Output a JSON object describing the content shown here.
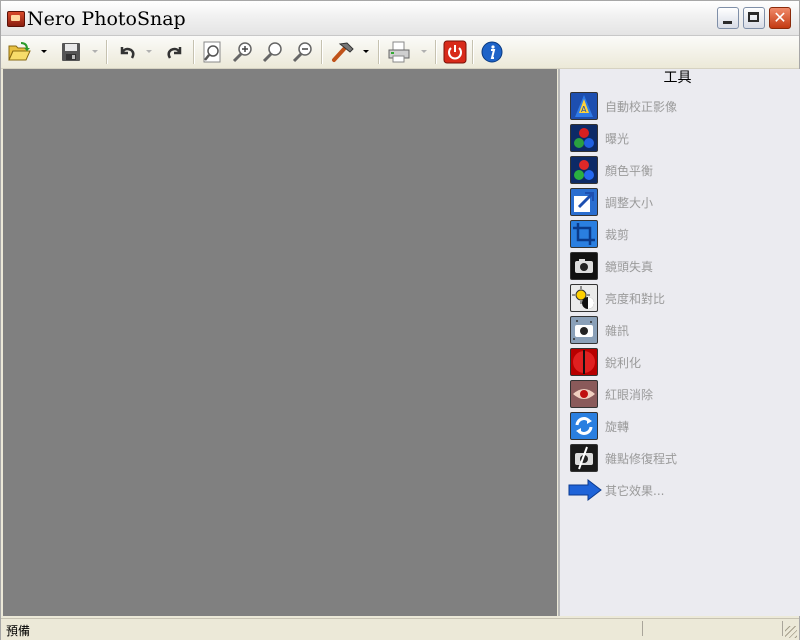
{
  "window": {
    "title": "Nero PhotoSnap"
  },
  "toolbar": {
    "buttons": [
      {
        "icon": "open-folder-icon"
      },
      {
        "icon": "save-icon"
      },
      {
        "icon": "undo-icon"
      },
      {
        "icon": "redo-icon"
      },
      {
        "icon": "zoom-fit-icon"
      },
      {
        "icon": "zoom-in-icon"
      },
      {
        "icon": "zoom-actual-icon"
      },
      {
        "icon": "zoom-out-icon"
      },
      {
        "icon": "hammer-tools-icon"
      },
      {
        "icon": "print-icon"
      },
      {
        "icon": "power-exit-icon"
      },
      {
        "icon": "info-icon"
      }
    ]
  },
  "panel": {
    "title": "工具",
    "tools": [
      {
        "label": "自動校正影像",
        "icon": "auto-correct-icon"
      },
      {
        "label": "曝光",
        "icon": "exposure-icon"
      },
      {
        "label": "顏色平衡",
        "icon": "color-balance-icon"
      },
      {
        "label": "調整大小",
        "icon": "resize-icon"
      },
      {
        "label": "裁剪",
        "icon": "crop-icon"
      },
      {
        "label": "鏡頭失真",
        "icon": "lens-distortion-icon"
      },
      {
        "label": "亮度和對比",
        "icon": "brightness-contrast-icon"
      },
      {
        "label": "雜訊",
        "icon": "noise-icon"
      },
      {
        "label": "銳利化",
        "icon": "sharpen-icon"
      },
      {
        "label": "紅眼消除",
        "icon": "red-eye-icon"
      },
      {
        "label": "旋轉",
        "icon": "rotate-icon"
      },
      {
        "label": "雜點修復程式",
        "icon": "spot-healing-icon"
      },
      {
        "label": "其它效果...",
        "icon": "arrow-right-icon"
      }
    ]
  },
  "status": {
    "text": "預備"
  },
  "colors": {
    "canvas": "#808080",
    "panel": "#ebebf0",
    "disabled_text": "#9a9a9a"
  }
}
